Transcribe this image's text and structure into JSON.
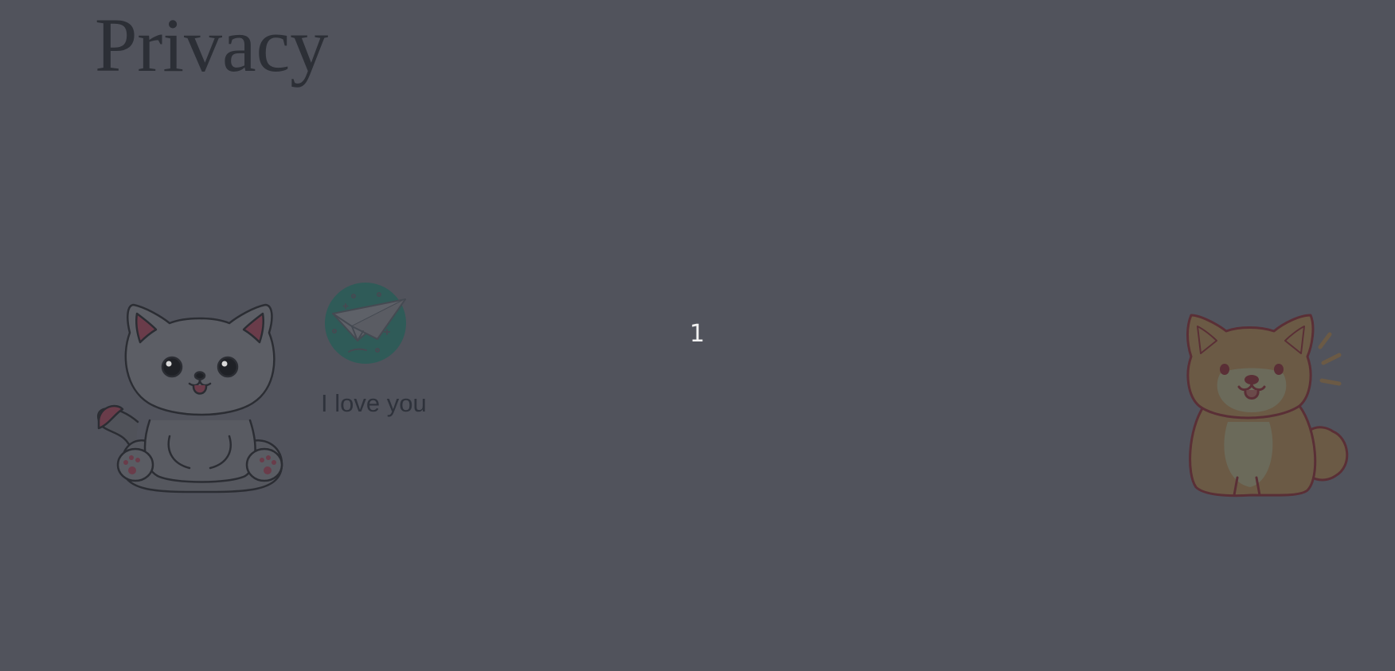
{
  "page": {
    "title": "Privacy",
    "background_color": "#51535c"
  },
  "decorations": {
    "cat_icon": "cat-icon",
    "dog_icon": "shiba-dog-icon"
  },
  "send": {
    "icon": "paper-plane-icon",
    "circle_color": "#2f5b58",
    "caption": "I love you"
  },
  "counter": {
    "value": "1"
  }
}
